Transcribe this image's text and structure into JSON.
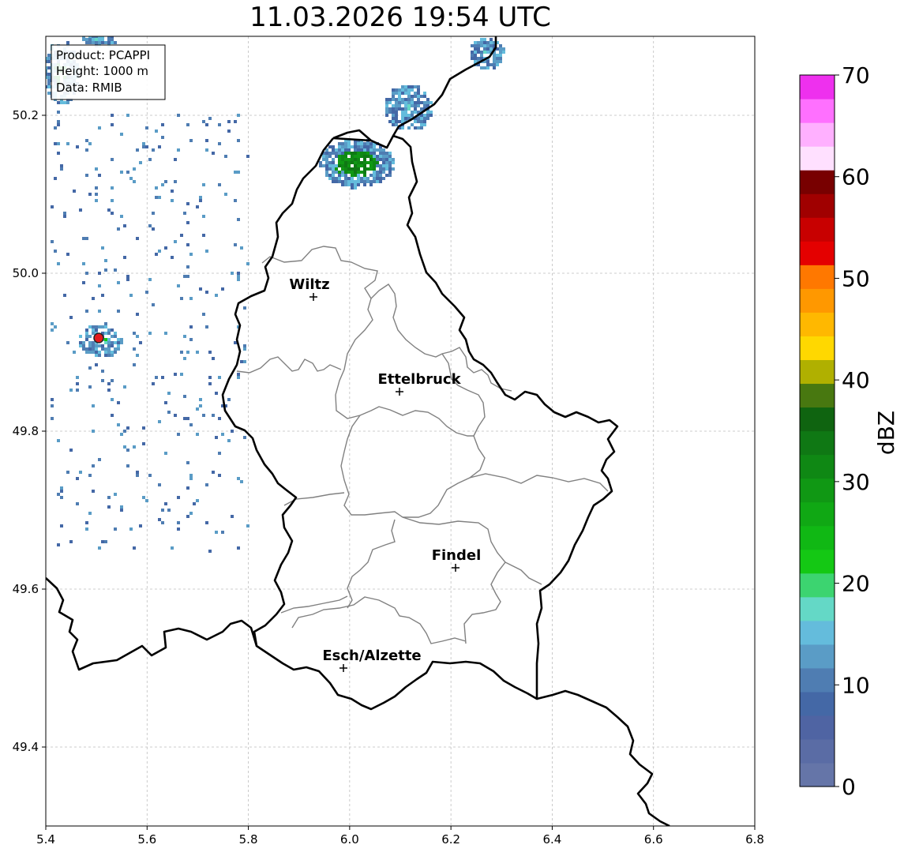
{
  "title": "11.03.2026 19:54 UTC",
  "info_box": {
    "product_line": "Product: PCAPPI",
    "height_line": "Height: 1000 m",
    "data_line": "Data: RMIB"
  },
  "map": {
    "lon_range": [
      5.4,
      6.8
    ],
    "lat_range": [
      49.3,
      50.3
    ],
    "x_ticks": [
      {
        "value": 5.4,
        "label": "5.4"
      },
      {
        "value": 5.6,
        "label": "5.6"
      },
      {
        "value": 5.8,
        "label": "5.8"
      },
      {
        "value": 6.0,
        "label": "6.0"
      },
      {
        "value": 6.2,
        "label": "6.2"
      },
      {
        "value": 6.4,
        "label": "6.4"
      },
      {
        "value": 6.6,
        "label": "6.6"
      },
      {
        "value": 6.8,
        "label": "6.8"
      }
    ],
    "y_ticks": [
      {
        "value": 49.4,
        "label": "49.4"
      },
      {
        "value": 49.6,
        "label": "49.6"
      },
      {
        "value": 49.8,
        "label": "49.8"
      },
      {
        "value": 50.0,
        "label": "50.0"
      },
      {
        "value": 50.2,
        "label": "50.2"
      }
    ],
    "grid": true,
    "cities": [
      {
        "name": "Wiltz",
        "lon": 5.93,
        "lat": 49.97
      },
      {
        "name": "Ettelbruck",
        "lon": 6.1,
        "lat": 49.85
      },
      {
        "name": "Findel",
        "lon": 6.21,
        "lat": 49.63
      },
      {
        "name": "Esch/Alzette",
        "lon": 5.98,
        "lat": 49.5
      }
    ],
    "radar_site": {
      "lon": 5.505,
      "lat": 49.915,
      "color": "#e31a1c"
    },
    "border_color": "#000000",
    "canton_color": "#808080"
  },
  "colorbar": {
    "label": "dBZ",
    "min": 0,
    "max": 70,
    "step": 2.5,
    "ticks": [
      {
        "value": 0,
        "label": "0"
      },
      {
        "value": 10,
        "label": "10"
      },
      {
        "value": 20,
        "label": "20"
      },
      {
        "value": 30,
        "label": "30"
      },
      {
        "value": 40,
        "label": "40"
      },
      {
        "value": 50,
        "label": "50"
      },
      {
        "value": 60,
        "label": "60"
      },
      {
        "value": 70,
        "label": "70"
      }
    ],
    "colors": [
      "#6575a8",
      "#5a6ca5",
      "#4f64a3",
      "#4468a6",
      "#4f7db2",
      "#5a9cc6",
      "#64bcdc",
      "#64d8c6",
      "#3cd470",
      "#14c814",
      "#10b814",
      "#10a814",
      "#109814",
      "#0f8814",
      "#0f7814",
      "#0f6410",
      "#487810",
      "#b0b000",
      "#ffd800",
      "#ffb800",
      "#ff9800",
      "#ff7800",
      "#e40000",
      "#c80000",
      "#a00000",
      "#780000",
      "#ffe0ff",
      "#ffb0ff",
      "#ff70ff",
      "#ee30ee"
    ]
  }
}
